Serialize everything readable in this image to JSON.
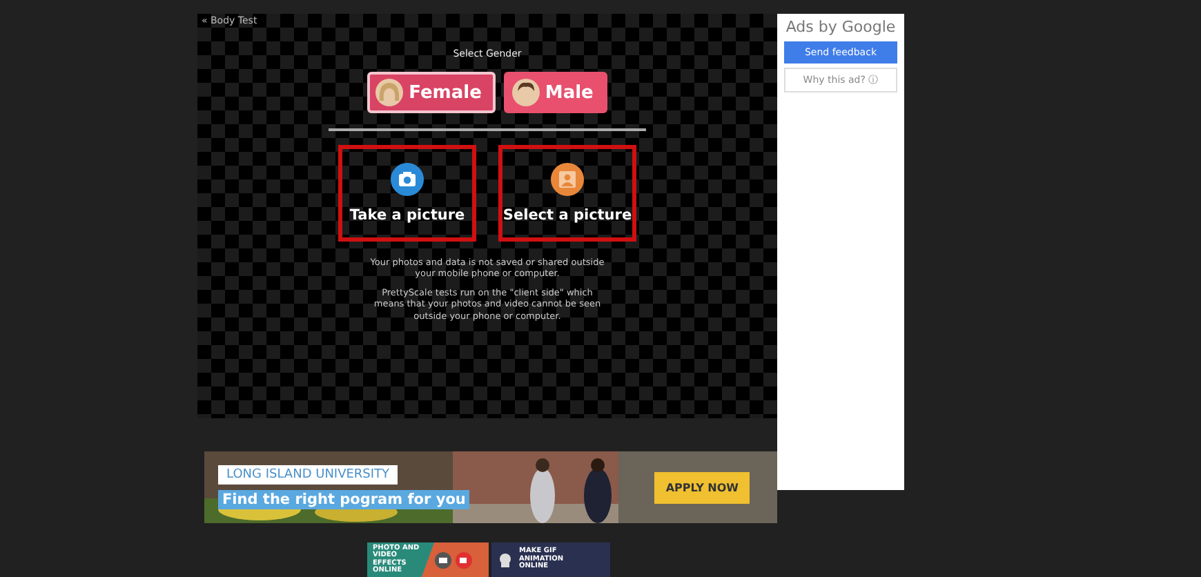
{
  "back_link": "« Body Test",
  "gender": {
    "title": "Select Gender",
    "options": [
      {
        "label": "Female",
        "selected": true
      },
      {
        "label": "Male",
        "selected": false
      }
    ]
  },
  "actions": [
    {
      "kind": "camera",
      "label": "Take a picture"
    },
    {
      "kind": "gallery",
      "label": "Select a picture"
    }
  ],
  "notes": [
    "Your photos and data is not saved or shared outside your mobile phone or computer.",
    "PrettyScale tests run on the \"client side\" which means that your photos and video cannot be seen outside your phone or computer."
  ],
  "ads_panel": {
    "title": "Ads by Google",
    "feedback_button": "Send feedback",
    "why_button": "Why this ad? ⓘ"
  },
  "banner": {
    "brand": "LONG ISLAND UNIVERSITY",
    "headline": "Find the right pogram for you",
    "cta": "APPLY NOW"
  },
  "promos": [
    {
      "kind": "effects",
      "label": "PHOTO AND VIDEO EFFECTS ONLINE"
    },
    {
      "kind": "gif",
      "label": "MAKE GIF ANIMATION ONLINE"
    }
  ]
}
